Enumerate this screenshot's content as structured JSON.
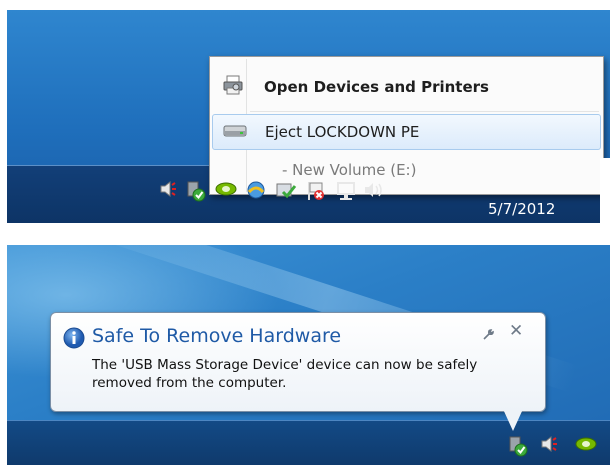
{
  "top": {
    "menu": {
      "items": [
        {
          "label": "Open Devices and Printers",
          "icon": "printer-icon",
          "bold": true
        },
        {
          "label": "Eject LOCKDOWN PE",
          "icon": "drive-icon",
          "highlighted": true
        },
        {
          "label": "- New Volume (E:)",
          "icon": "none",
          "disabled": true
        }
      ]
    },
    "tray_icons": [
      "speaker-icon",
      "safe-remove-hardware-icon",
      "nvidia-icon",
      "network-share-icon",
      "action-center-icon",
      "flag-error-icon",
      "network-icon",
      "volume-icon"
    ],
    "clock": "5/7/2012"
  },
  "bottom": {
    "balloon": {
      "title": "Safe To Remove Hardware",
      "message": "The 'USB Mass Storage Device' device can now be safely removed from the computer.",
      "icons": [
        "info-icon",
        "wrench-icon",
        "close-icon"
      ]
    },
    "tray_icons": [
      "safe-remove-hardware-icon",
      "speaker-icon",
      "nvidia-icon"
    ]
  },
  "colors": {
    "desktop_blue": "#2b7fc7",
    "taskbar": "#0f3a6c",
    "menu_highlight": "#dcebfb",
    "balloon_title": "#1f5aa6"
  }
}
